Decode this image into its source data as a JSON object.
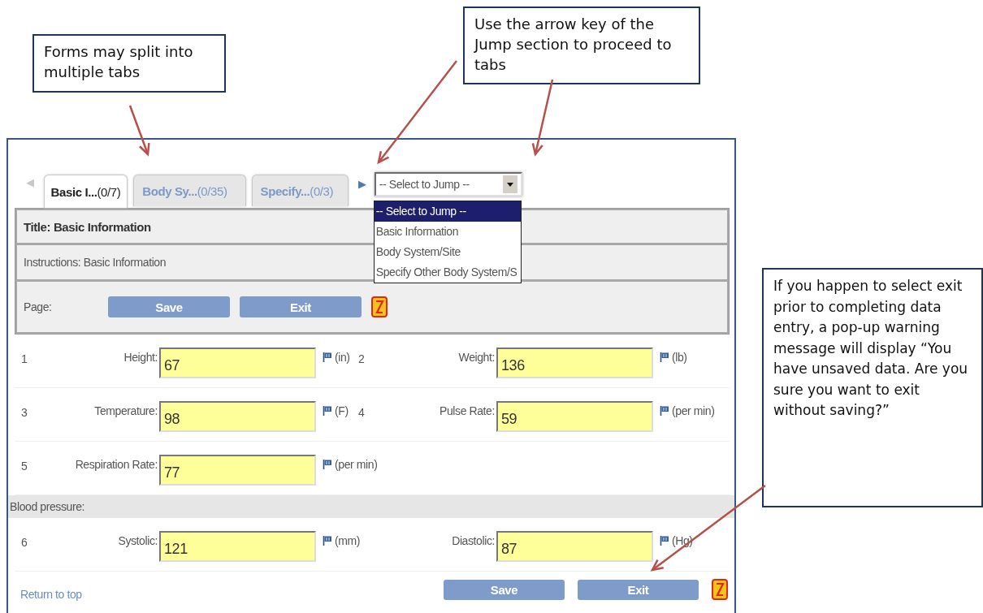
{
  "callouts": [
    {
      "text": "Forms may split into multiple tabs"
    },
    {
      "text": "Use the arrow key of the Jump section to proceed to tabs"
    },
    {
      "text": "If you happen to select exit prior to completing data entry, a pop-up warning message will display “You have unsaved data. Are you sure you want to exit without saving?”"
    }
  ],
  "tab_nav": {
    "prev": {
      "glyph": "◀",
      "disabled": true
    },
    "next": {
      "glyph": "▶",
      "disabled": false
    }
  },
  "tabs": [
    {
      "label": "Basic I...",
      "count": "(0/7)",
      "selected": true
    },
    {
      "label": "Body Sy...",
      "count": "(0/35)",
      "selected": false
    },
    {
      "label": "Specify...",
      "count": "(0/3)",
      "selected": false
    }
  ],
  "jump_select": {
    "value": "-- Select to Jump --",
    "expanded": true,
    "options": [
      {
        "label": "-- Select to Jump --",
        "selected": true
      },
      {
        "label": "Basic Information",
        "selected": false
      },
      {
        "label": "Body System/Site",
        "selected": false
      },
      {
        "label": "Specify Other Body System/S",
        "selected": false
      }
    ]
  },
  "title": "Title: Basic Information",
  "instructions": "Instructions: Basic Information",
  "page_bar": {
    "label": "Page:",
    "buttons": [
      "Save",
      "Exit"
    ]
  },
  "rows": [
    {
      "kind": "fields",
      "fields": [
        {
          "number": "1",
          "label": "Height:",
          "value": "67",
          "unit": "(in)"
        },
        {
          "number": "2",
          "label": "Weight:",
          "value": "136",
          "unit": "(lb)"
        }
      ]
    },
    {
      "kind": "fields",
      "fields": [
        {
          "number": "3",
          "label": "Temperature:",
          "value": "98",
          "unit": "(F)"
        },
        {
          "number": "4",
          "label": "Pulse Rate:",
          "value": "59",
          "unit": "(per min)"
        }
      ]
    },
    {
      "kind": "fields",
      "fields": [
        {
          "number": "5",
          "label": "Respiration Rate:",
          "value": "77",
          "unit": "(per min)"
        }
      ]
    },
    {
      "kind": "heading",
      "text": "Blood pressure:"
    },
    {
      "kind": "fields",
      "fields": [
        {
          "number": "6",
          "label": "Systolic:",
          "value": "121",
          "unit": "(mm)"
        },
        {
          "label": "Diastolic:",
          "value": "87",
          "unit": "(Hg)"
        }
      ]
    }
  ],
  "footer": {
    "link": "Return to top",
    "buttons": [
      "Save",
      "Exit"
    ]
  }
}
